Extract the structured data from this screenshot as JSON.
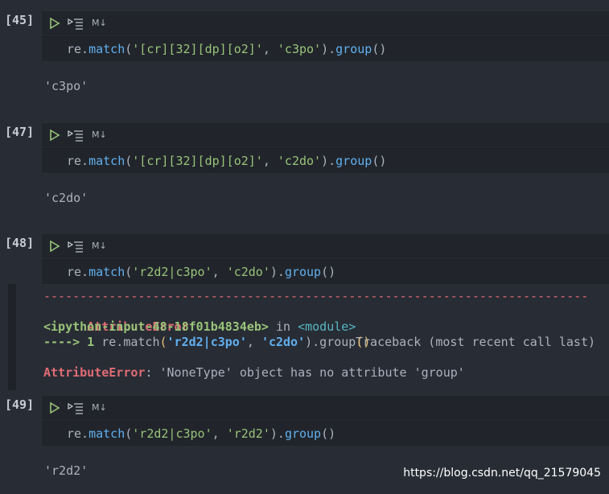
{
  "toolbar": {
    "run_icon": "run-icon",
    "run_all_icon": "run-all-icon",
    "markdown_label": "M↓"
  },
  "cells": [
    {
      "prompt": "[45]",
      "code": {
        "obj": "re.",
        "fn": "match",
        "open": "(",
        "arg1": "'[cr][32][dp][o2]'",
        "sep": ", ",
        "arg2": "'c3po'",
        "close": ").",
        "fn2": "group",
        "end": "()"
      },
      "output": "'c3po'"
    },
    {
      "prompt": "[47]",
      "code": {
        "obj": "re.",
        "fn": "match",
        "open": "(",
        "arg1": "'[cr][32][dp][o2]'",
        "sep": ", ",
        "arg2": "'c2do'",
        "close": ").",
        "fn2": "group",
        "end": "()"
      },
      "output": "'c2do'"
    },
    {
      "prompt": "[48]",
      "code": {
        "obj": "re.",
        "fn": "match",
        "open": "(",
        "arg1": "'r2d2|c3po'",
        "sep": ", ",
        "arg2": "'c2do'",
        "close": ").",
        "fn2": "group",
        "end": "()"
      },
      "error": {
        "dashes": "---------------------------------------------------------------------------",
        "error_name": "AttributeError",
        "traceback_label": "Traceback (most recent call last)",
        "input_ref": "<ipython-input-48-18f01b4834eb>",
        "in_word": " in ",
        "module_ref": "<module>",
        "arrow": "----> 1 ",
        "tb_obj": "re.match",
        "tb_open": "(",
        "tb_arg1": "'r2d2|c3po'",
        "tb_sep": ", ",
        "tb_arg2": "'c2do'",
        "tb_close": ").group",
        "tb_end": "()",
        "final_name": "AttributeError",
        "final_msg": ": 'NoneType' object has no attribute 'group'"
      }
    },
    {
      "prompt": "[49]",
      "code": {
        "obj": "re.",
        "fn": "match",
        "open": "(",
        "arg1": "'r2d2|c3po'",
        "sep": ", ",
        "arg2": "'r2d2'",
        "close": ").",
        "fn2": "group",
        "end": "()"
      },
      "output": "'r2d2'"
    }
  ],
  "watermark": "https://blog.csdn.net/qq_21579045",
  "colors": {
    "background": "#282c34",
    "cell": "#21252b",
    "string": "#98c379",
    "function": "#61afef",
    "error": "#e06c75"
  }
}
